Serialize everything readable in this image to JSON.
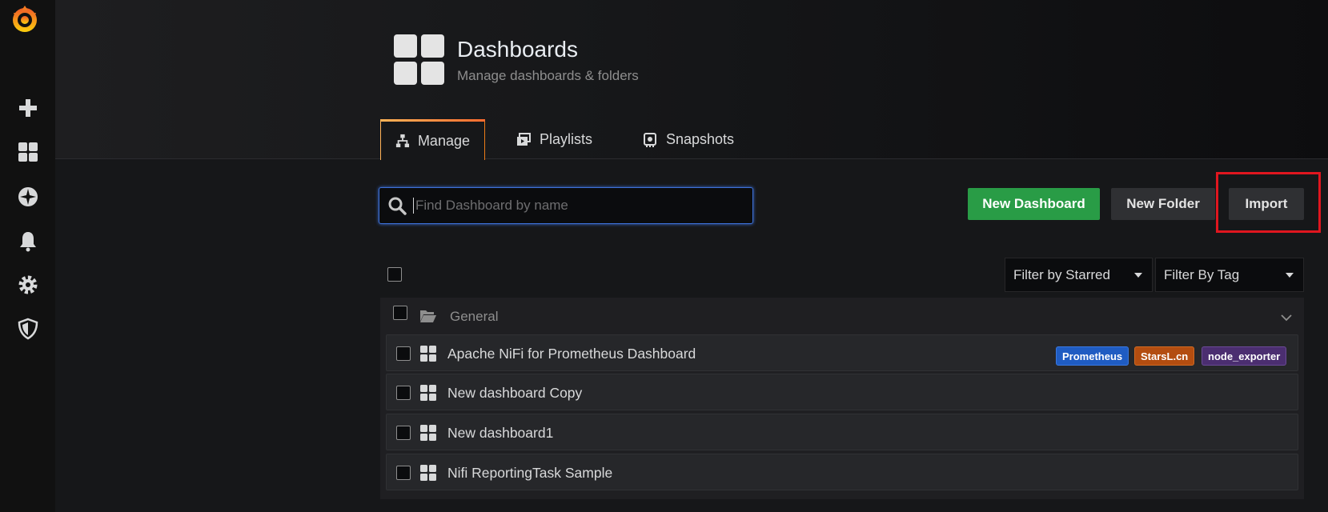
{
  "header": {
    "title": "Dashboards",
    "subtitle": "Manage dashboards & folders"
  },
  "tabs": [
    {
      "label": "Manage",
      "icon": "sitemap-icon",
      "active": true
    },
    {
      "label": "Playlists",
      "icon": "playlist-icon",
      "active": false
    },
    {
      "label": "Snapshots",
      "icon": "snapshot-icon",
      "active": false
    }
  ],
  "search": {
    "placeholder": "Find Dashboard by name",
    "value": ""
  },
  "actions": {
    "new_dashboard": "New Dashboard",
    "new_folder": "New Folder",
    "import": "Import"
  },
  "filters": {
    "starred": "Filter by Starred",
    "tag": "Filter By Tag"
  },
  "folder": {
    "name": "General"
  },
  "dashboards": [
    {
      "title": "Apache NiFi for Prometheus Dashboard",
      "tags": [
        "Prometheus",
        "StarsL.cn",
        "node_exporter"
      ]
    },
    {
      "title": "New dashboard Copy",
      "tags": []
    },
    {
      "title": "New dashboard1",
      "tags": []
    },
    {
      "title": "Nifi ReportingTask Sample",
      "tags": []
    }
  ],
  "colors": {
    "accent_green": "#299c46",
    "tag_prometheus": "#1f5cc2",
    "tag_starsl": "#b34d10",
    "tag_node_exporter": "#4b2e70",
    "highlight": "#e0161f"
  }
}
